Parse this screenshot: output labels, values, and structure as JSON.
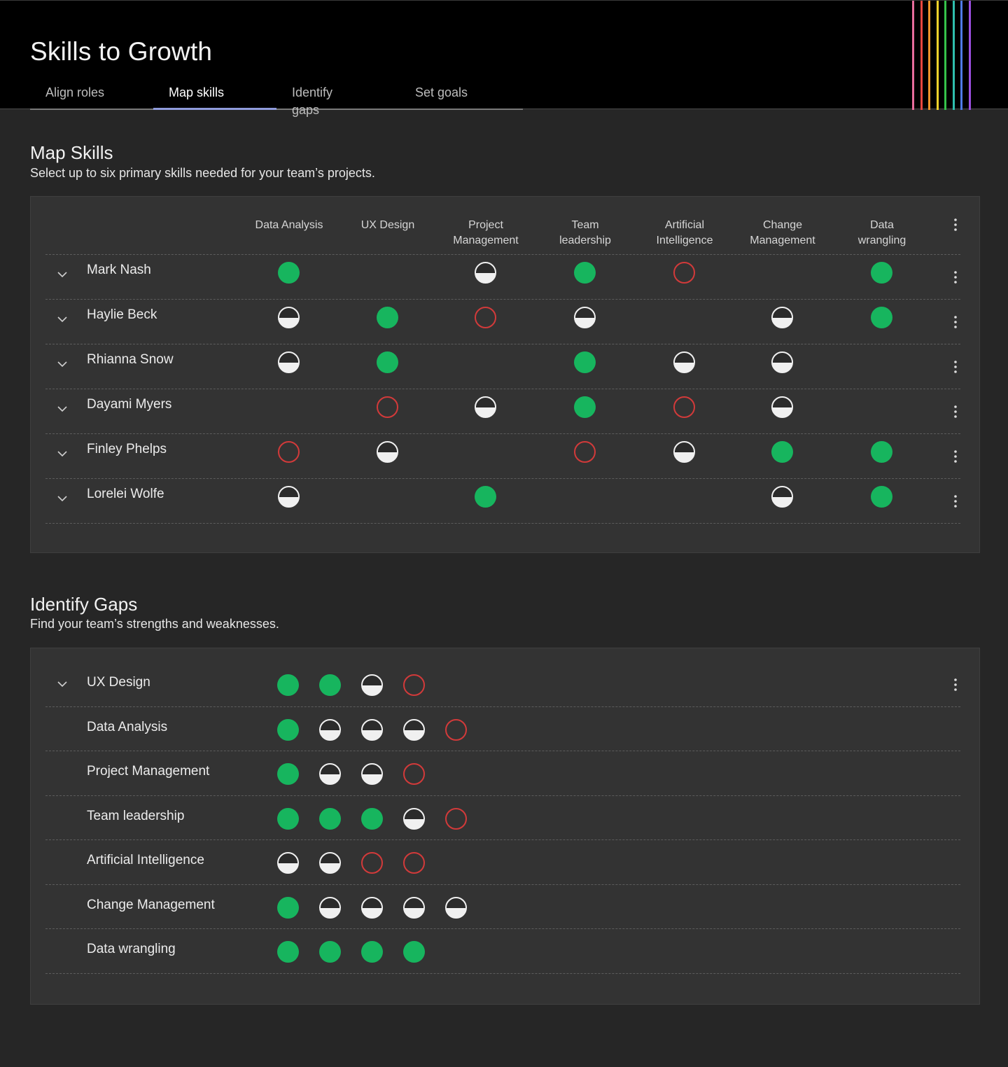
{
  "app": {
    "title": "Skills to Growth",
    "tabs": [
      {
        "label": "Align roles",
        "active": false
      },
      {
        "label": "Map skills",
        "active": true
      },
      {
        "label": "Identify gaps",
        "active": false
      },
      {
        "label": "Set goals",
        "active": false
      }
    ],
    "stripe_colors": [
      "#e86d9c",
      "#e8473f",
      "#f0952a",
      "#f5d22a",
      "#35c24a",
      "#2fbfae",
      "#4f7be8",
      "#9b4fe0"
    ]
  },
  "legend": {
    "full": "#17b55e",
    "partial": "#f0f0f0",
    "gap": "#d23a3a"
  },
  "map_skills": {
    "title": "Map Skills",
    "subtitle": "Select up to six primary skills needed for your team’s projects.",
    "columns": [
      {
        "label": "Data Analysis"
      },
      {
        "label": "UX Design"
      },
      {
        "label": "Project Management"
      },
      {
        "label": "Team leadership"
      },
      {
        "label": "Artificial Intelligence"
      },
      {
        "label": "Change Management"
      },
      {
        "label": "Data wrangling"
      }
    ],
    "rows": [
      {
        "name": "Mark Nash",
        "levels": [
          "full",
          "",
          "half",
          "full",
          "empty",
          "",
          "full"
        ]
      },
      {
        "name": "Haylie Beck",
        "levels": [
          "half",
          "full",
          "empty",
          "half",
          "",
          "half",
          "full"
        ]
      },
      {
        "name": "Rhianna Snow",
        "levels": [
          "half",
          "full",
          "",
          "full",
          "half",
          "half",
          ""
        ]
      },
      {
        "name": "Dayami Myers",
        "levels": [
          "",
          "empty",
          "half",
          "full",
          "empty",
          "half",
          ""
        ]
      },
      {
        "name": "Finley Phelps",
        "levels": [
          "empty",
          "half",
          "",
          "empty",
          "half",
          "full",
          "full"
        ]
      },
      {
        "name": "Lorelei Wolfe",
        "levels": [
          "half",
          "",
          "full",
          "",
          "",
          "half",
          "full"
        ]
      }
    ]
  },
  "identify_gaps": {
    "title": "Identify Gaps",
    "subtitle": "Find your team’s strengths and weaknesses.",
    "rows": [
      {
        "name": "UX Design",
        "expandable": true,
        "levels": [
          "full",
          "full",
          "half",
          "empty"
        ]
      },
      {
        "name": "Data Analysis",
        "expandable": false,
        "levels": [
          "full",
          "half",
          "half",
          "half",
          "empty"
        ]
      },
      {
        "name": "Project Management",
        "expandable": false,
        "levels": [
          "full",
          "half",
          "half",
          "empty"
        ]
      },
      {
        "name": "Team leadership",
        "expandable": false,
        "levels": [
          "full",
          "full",
          "full",
          "half",
          "empty"
        ]
      },
      {
        "name": "Artificial Intelligence",
        "expandable": false,
        "levels": [
          "half",
          "half",
          "empty",
          "empty"
        ]
      },
      {
        "name": "Change Management",
        "expandable": false,
        "levels": [
          "full",
          "half",
          "half",
          "half",
          "half"
        ]
      },
      {
        "name": "Data wrangling",
        "expandable": false,
        "levels": [
          "full",
          "full",
          "full",
          "full"
        ]
      }
    ]
  }
}
